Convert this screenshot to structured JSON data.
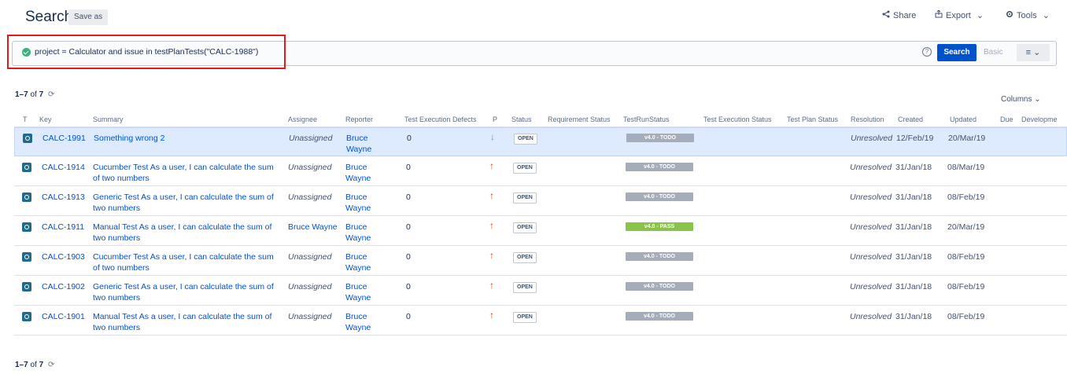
{
  "header": {
    "title": "Search",
    "save_as": "Save as",
    "share": "Share",
    "export": "Export",
    "tools": "Tools",
    "chevron": "⌄",
    "share_icon": "share-icon",
    "export_icon": "export-icon",
    "tools_icon": "gear-icon"
  },
  "query": {
    "text": "project = Calculator and issue in testPlanTests(\"CALC-1988\")",
    "help": "?",
    "search": "Search",
    "basic": "Basic",
    "menu": "≡ ⌄"
  },
  "pagination": {
    "range": "1–7",
    "of": "of",
    "total": "7",
    "refresh": "⟳"
  },
  "columns_button": "Columns",
  "table": {
    "headers": {
      "t": "T",
      "key": "Key",
      "summary": "Summary",
      "assignee": "Assignee",
      "reporter": "Reporter",
      "defects": "Test Execution Defects",
      "p": "P",
      "status": "Status",
      "req": "Requirement Status",
      "trs": "TestRunStatus",
      "tes": "Test Execution Status",
      "tps": "Test Plan Status",
      "resolution": "Resolution",
      "created": "Created",
      "updated": "Updated",
      "due": "Due",
      "dev": "Developme"
    },
    "rows": [
      {
        "key": "CALC-1991",
        "summary": "Something wrong 2",
        "assignee": "Unassigned",
        "reporter": "Bruce Wayne",
        "defects": "0",
        "prio": "↓",
        "status": "OPEN",
        "trs": "v4.0 - TODO",
        "resolution": "Unresolved",
        "created": "12/Feb/19",
        "updated": "20/Mar/19"
      },
      {
        "key": "CALC-1914",
        "summary": "Cucumber Test As a user, I can calculate the sum of two numbers",
        "assignee": "Unassigned",
        "reporter": "Bruce Wayne",
        "defects": "0",
        "prio": "↑",
        "status": "OPEN",
        "trs": "v4.0 - TODO",
        "resolution": "Unresolved",
        "created": "31/Jan/18",
        "updated": "08/Mar/19"
      },
      {
        "key": "CALC-1913",
        "summary": "Generic Test As a user, I can calculate the sum of two numbers",
        "assignee": "Unassigned",
        "reporter": "Bruce Wayne",
        "defects": "0",
        "prio": "↑",
        "status": "OPEN",
        "trs": "v4.0 - TODO",
        "resolution": "Unresolved",
        "created": "31/Jan/18",
        "updated": "08/Feb/19"
      },
      {
        "key": "CALC-1911",
        "summary": "Manual Test As a user, I can calculate the sum of two numbers",
        "assignee": "Bruce Wayne",
        "reporter": "Bruce Wayne",
        "defects": "0",
        "prio": "↑",
        "status": "OPEN",
        "trs": "v4.0 - PASS",
        "resolution": "Unresolved",
        "created": "31/Jan/18",
        "updated": "20/Mar/19"
      },
      {
        "key": "CALC-1903",
        "summary": "Cucumber Test As a user, I can calculate the sum of two numbers",
        "assignee": "Unassigned",
        "reporter": "Bruce Wayne",
        "defects": "0",
        "prio": "↑",
        "status": "OPEN",
        "trs": "v4.0 - TODO",
        "resolution": "Unresolved",
        "created": "31/Jan/18",
        "updated": "08/Feb/19"
      },
      {
        "key": "CALC-1902",
        "summary": "Generic Test As a user, I can calculate the sum of two numbers",
        "assignee": "Unassigned",
        "reporter": "Bruce Wayne",
        "defects": "0",
        "prio": "↑",
        "status": "OPEN",
        "trs": "v4.0 - TODO",
        "resolution": "Unresolved",
        "created": "31/Jan/18",
        "updated": "08/Feb/19"
      },
      {
        "key": "CALC-1901",
        "summary": "Manual Test As a user, I can calculate the sum of two numbers",
        "assignee": "Unassigned",
        "reporter": "Bruce Wayne",
        "defects": "0",
        "prio": "↑",
        "status": "OPEN",
        "trs": "v4.0 - TODO",
        "resolution": "Unresolved",
        "created": "31/Jan/18",
        "updated": "08/Feb/19"
      }
    ]
  },
  "colors": {
    "accent": "#0052cc",
    "todo": "#a5adba",
    "pass": "#8bc34a",
    "prio_high": "#de350b",
    "prio_low": "#36b37e",
    "selected_row": "#deebff"
  }
}
